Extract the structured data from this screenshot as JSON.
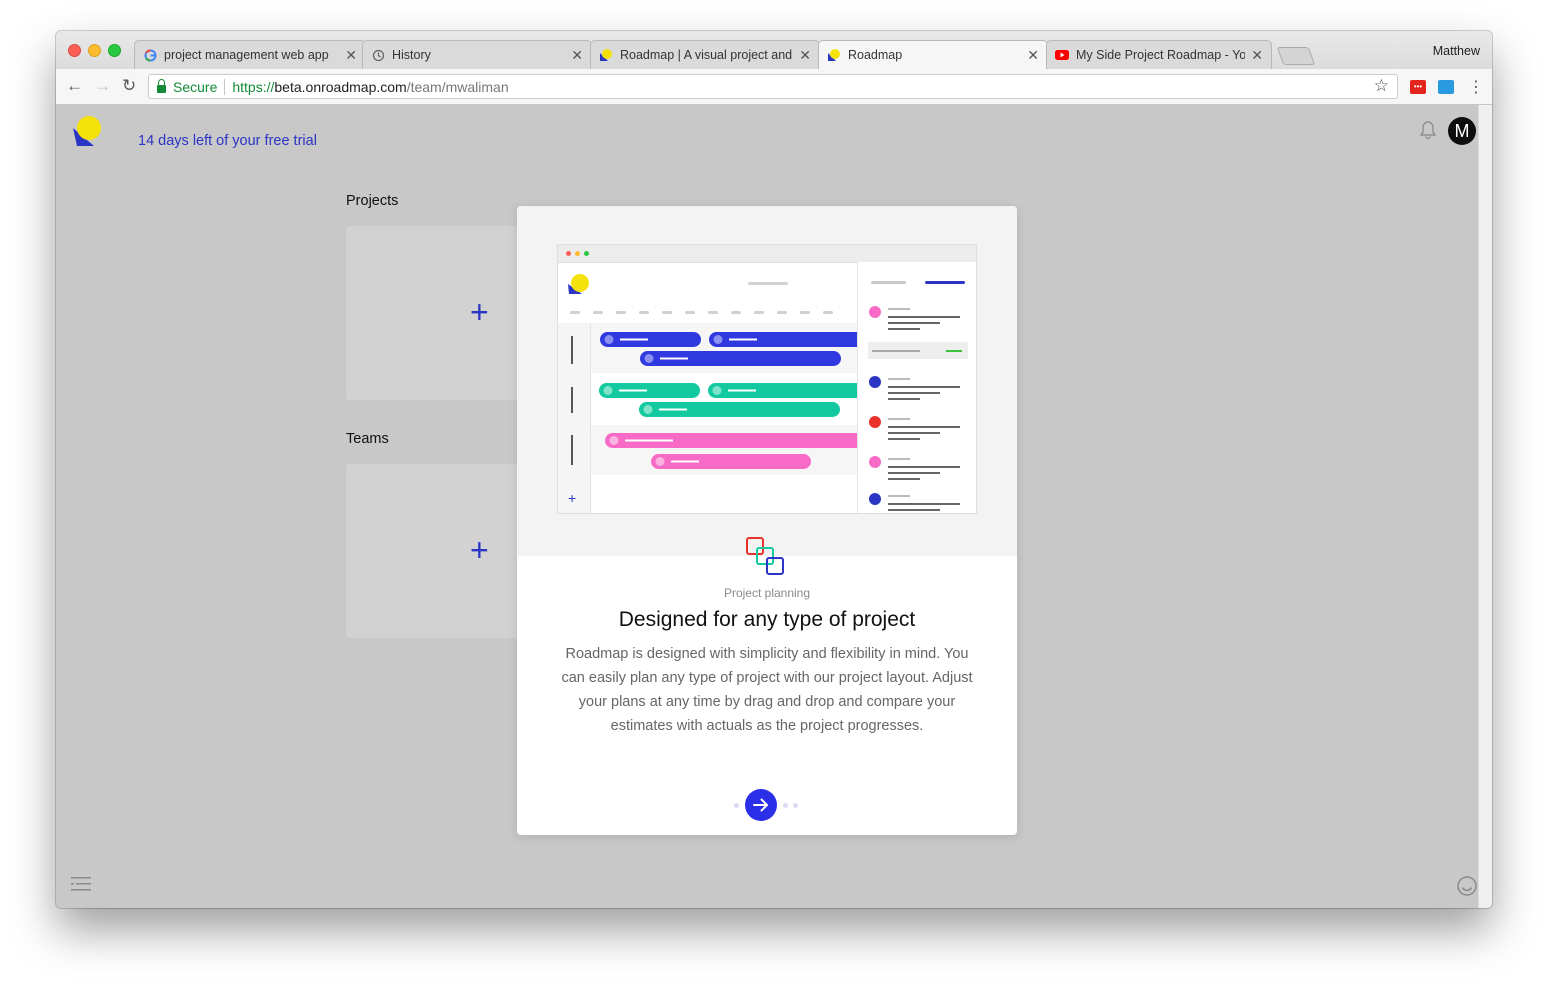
{
  "browser": {
    "tabs": [
      {
        "title": "project management web app",
        "favicon": "google-icon",
        "active": false
      },
      {
        "title": "History",
        "favicon": "history-icon",
        "active": false
      },
      {
        "title": "Roadmap | A visual project and",
        "favicon": "roadmap-icon",
        "active": false
      },
      {
        "title": "Roadmap",
        "favicon": "roadmap-icon",
        "active": true
      },
      {
        "title": "My Side Project Roadmap - Yo",
        "favicon": "youtube-icon",
        "active": false
      }
    ],
    "profile_name": "Matthew",
    "secure_label": "Secure",
    "url_scheme": "https://",
    "url_host": "beta.onroadmap.com",
    "url_path": "/team/mwaliman"
  },
  "app": {
    "trial_text": "14 days left of your free trial",
    "avatar_initial": "M",
    "projects_label": "Projects",
    "teams_label": "Teams"
  },
  "modal": {
    "eyebrow": "Project planning",
    "headline": "Designed for any type of project",
    "body": "Roadmap is designed with simplicity and flexibility in mind. You can easily plan any type of project with our project layout. Adjust your plans at any time by drag and drop and compare your estimates with actuals as the project progresses.",
    "pager_total": 4,
    "pager_current": 1
  },
  "colors": {
    "accent_blue": "#2b35c4",
    "bar_blue": "#3039e0",
    "bar_green": "#13c9a0",
    "bar_pink": "#f76bc6",
    "logo_yellow": "#f4e20a"
  }
}
